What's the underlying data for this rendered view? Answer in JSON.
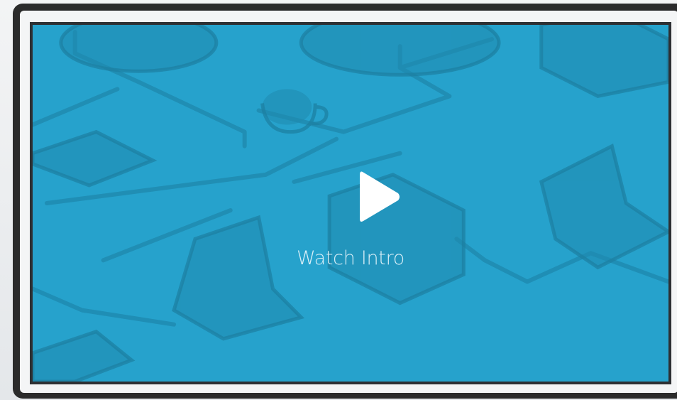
{
  "video": {
    "label": "Watch Intro",
    "play_icon": "play-icon",
    "accent_color": "#26a2cc"
  }
}
